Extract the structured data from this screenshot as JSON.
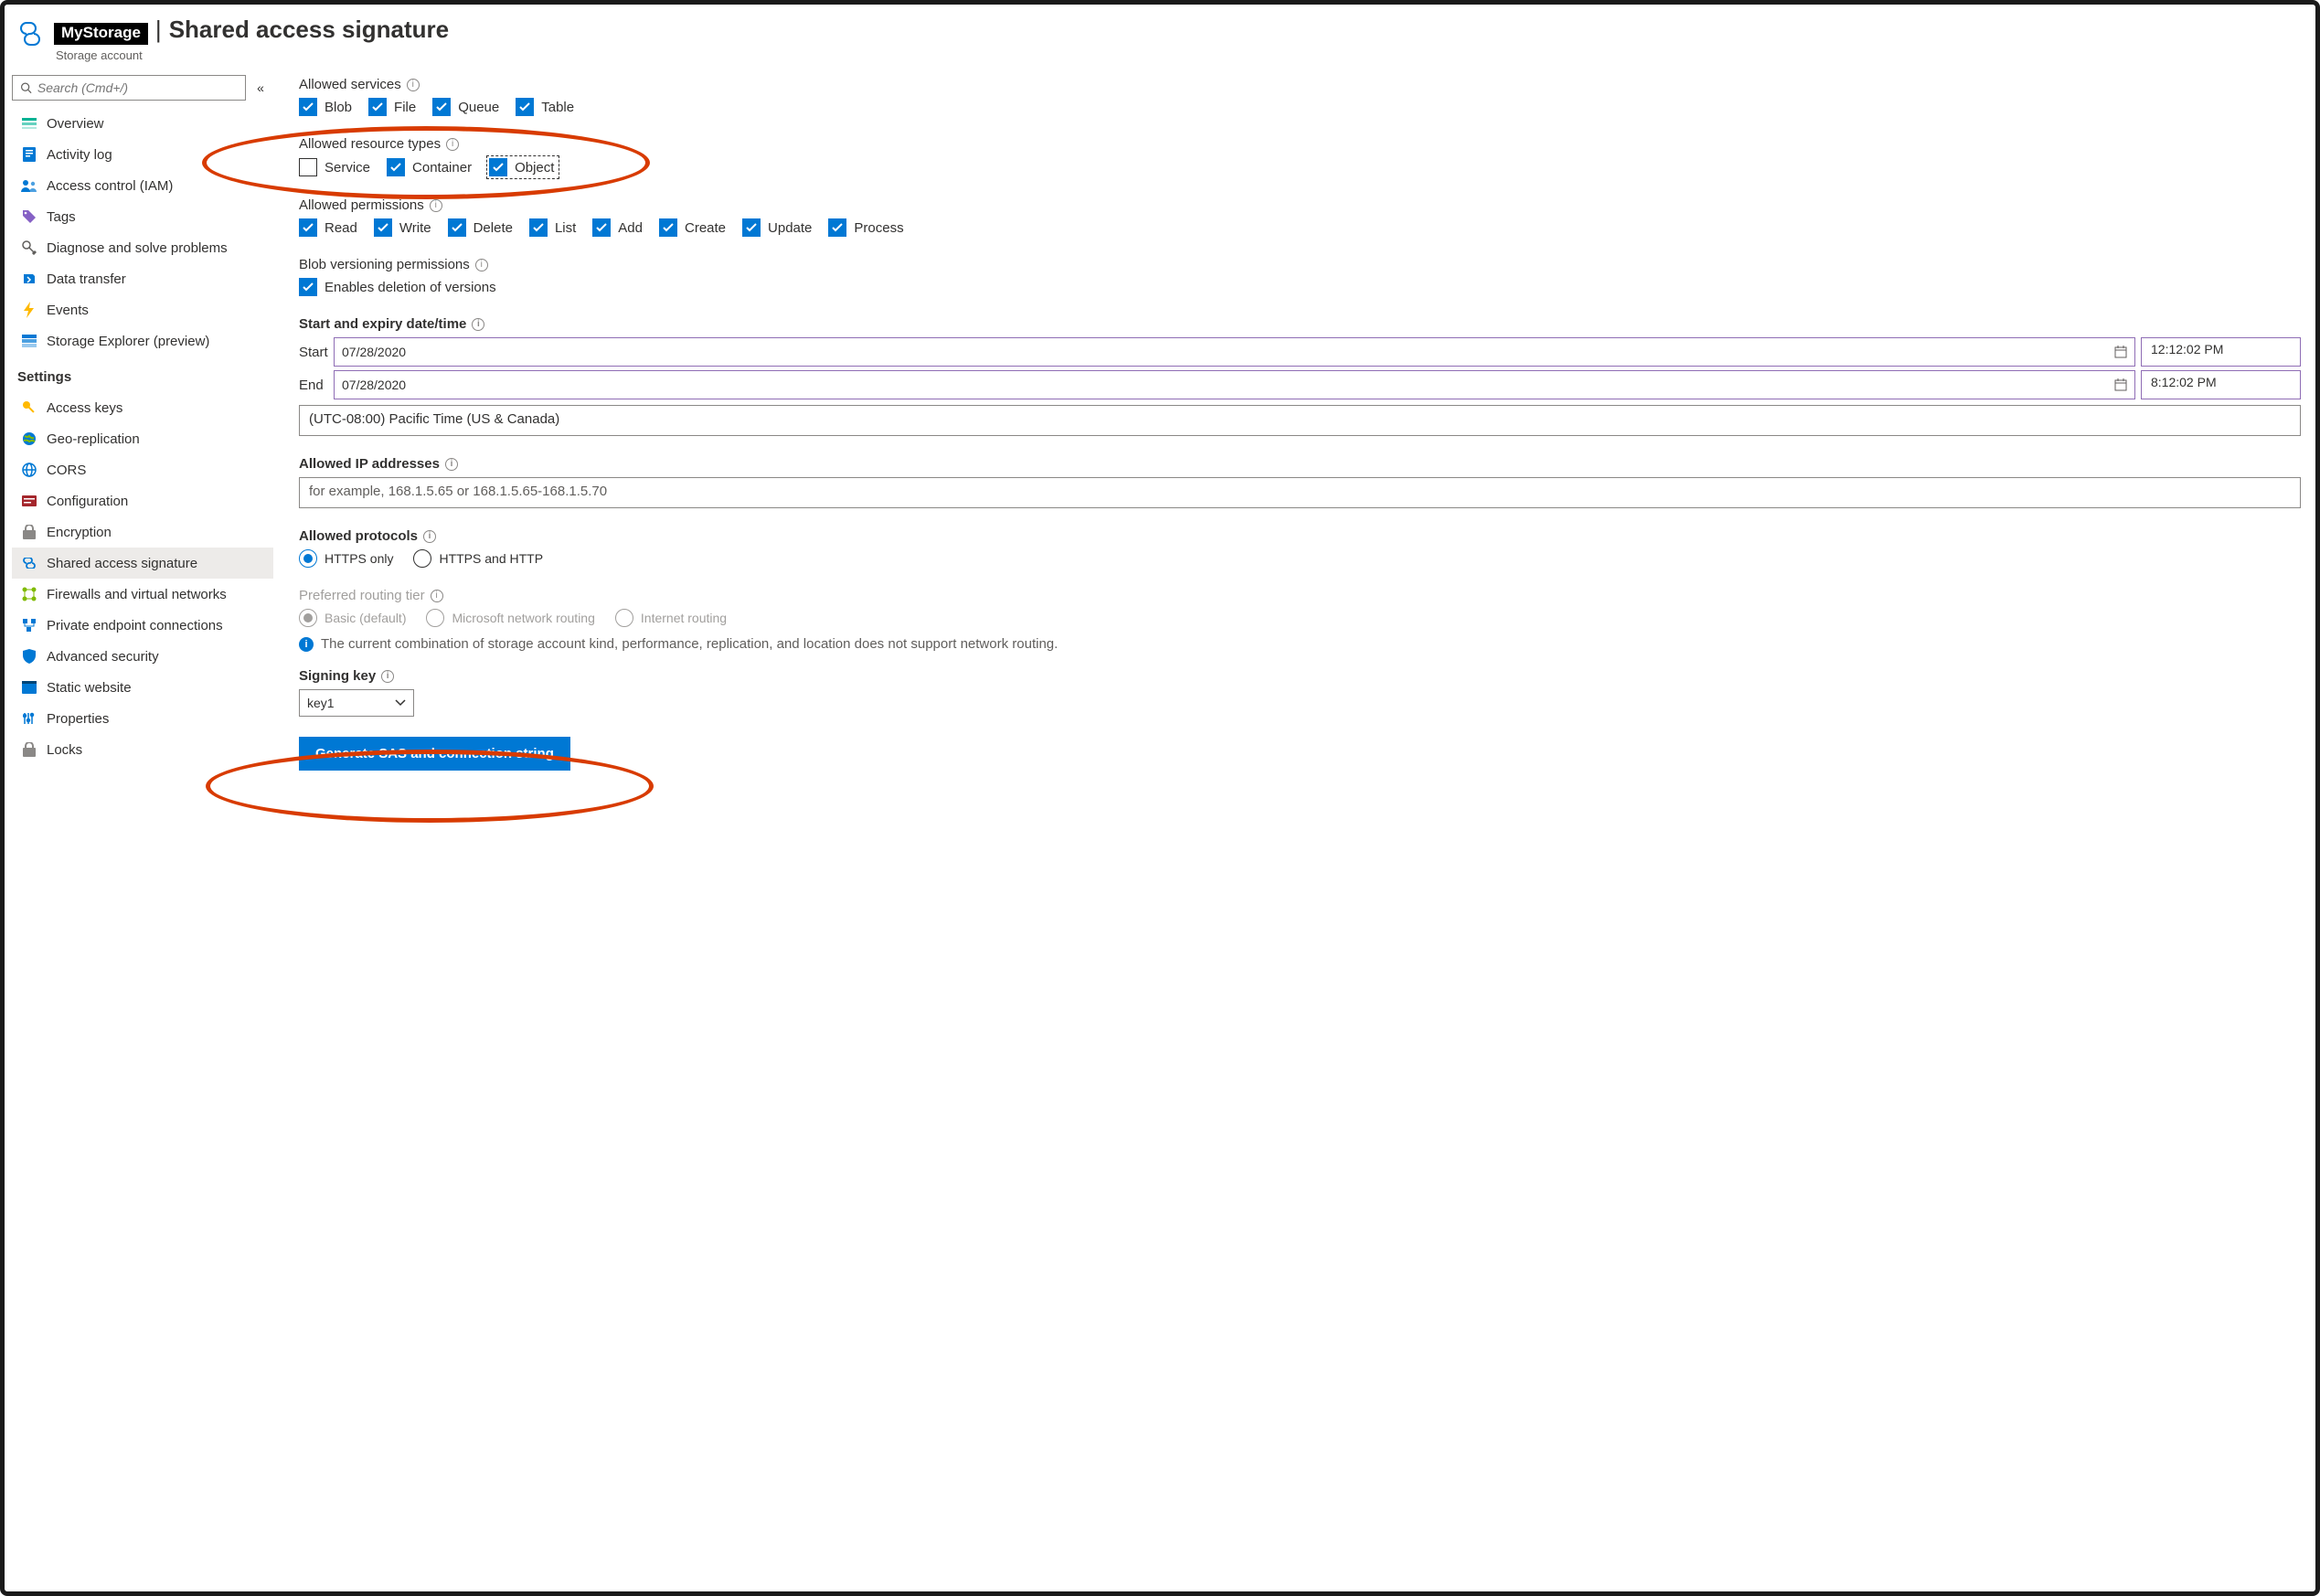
{
  "header": {
    "storage_name": "MyStorage",
    "page_title": "Shared access signature",
    "subtitle": "Storage account"
  },
  "search": {
    "placeholder": "Search (Cmd+/)"
  },
  "sidebar": {
    "items": [
      {
        "label": "Overview"
      },
      {
        "label": "Activity log"
      },
      {
        "label": "Access control (IAM)"
      },
      {
        "label": "Tags"
      },
      {
        "label": "Diagnose and solve problems"
      },
      {
        "label": "Data transfer"
      },
      {
        "label": "Events"
      },
      {
        "label": "Storage Explorer (preview)"
      }
    ],
    "settings_header": "Settings",
    "settings": [
      {
        "label": "Access keys"
      },
      {
        "label": "Geo-replication"
      },
      {
        "label": "CORS"
      },
      {
        "label": "Configuration"
      },
      {
        "label": "Encryption"
      },
      {
        "label": "Shared access signature"
      },
      {
        "label": "Firewalls and virtual networks"
      },
      {
        "label": "Private endpoint connections"
      },
      {
        "label": "Advanced security"
      },
      {
        "label": "Static website"
      },
      {
        "label": "Properties"
      },
      {
        "label": "Locks"
      }
    ]
  },
  "main": {
    "allowed_services": {
      "label": "Allowed services",
      "options": {
        "blob": "Blob",
        "file": "File",
        "queue": "Queue",
        "table": "Table"
      }
    },
    "allowed_resource_types": {
      "label": "Allowed resource types",
      "options": {
        "service": "Service",
        "container": "Container",
        "object": "Object"
      }
    },
    "allowed_permissions": {
      "label": "Allowed permissions",
      "options": {
        "read": "Read",
        "write": "Write",
        "delete": "Delete",
        "list": "List",
        "add": "Add",
        "create": "Create",
        "update": "Update",
        "process": "Process"
      }
    },
    "blob_versioning": {
      "label": "Blob versioning permissions",
      "option": "Enables deletion of versions"
    },
    "datetime": {
      "label": "Start and expiry date/time",
      "start_label": "Start",
      "end_label": "End",
      "start_date": "07/28/2020",
      "start_time": "12:12:02 PM",
      "end_date": "07/28/2020",
      "end_time": "8:12:02 PM",
      "timezone": "(UTC-08:00) Pacific Time (US & Canada)"
    },
    "allowed_ip": {
      "label": "Allowed IP addresses",
      "placeholder": "for example, 168.1.5.65 or 168.1.5.65-168.1.5.70"
    },
    "allowed_protocols": {
      "label": "Allowed protocols",
      "https_only": "HTTPS only",
      "https_http": "HTTPS and HTTP"
    },
    "routing": {
      "label": "Preferred routing tier",
      "basic": "Basic (default)",
      "ms": "Microsoft network routing",
      "internet": "Internet routing",
      "note": "The current combination of storage account kind, performance, replication, and location does not support network routing."
    },
    "signing_key": {
      "label": "Signing key",
      "value": "key1"
    },
    "generate_button": "Generate SAS and connection string"
  }
}
